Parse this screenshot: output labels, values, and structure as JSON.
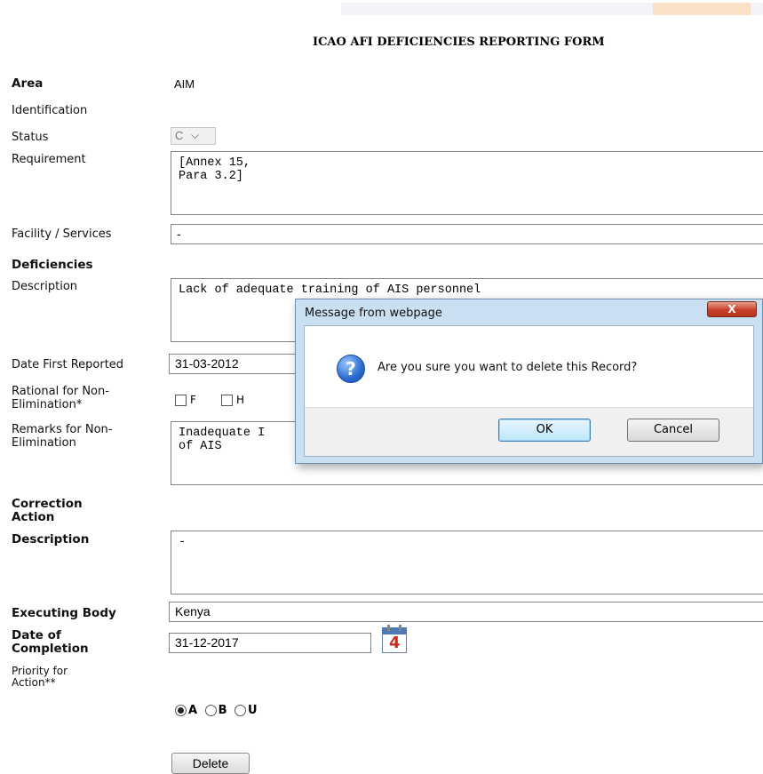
{
  "form": {
    "title": "ICAO AFI DEFICIENCIES REPORTING FORM",
    "area_label": "Area",
    "area_value": "AIM",
    "identification_label": "Identification",
    "status_label": "Status",
    "status_value": "C",
    "requirement_label": "Requirement",
    "requirement_value": "[Annex 15,\nPara 3.2]",
    "facility_label": "Facility / Services",
    "facility_value": "-",
    "deficiencies_heading": "Deficiencies",
    "description_label": "Description",
    "description_value": "Lack of adequate training of AIS personnel",
    "date_first_reported_label": "Date First Reported",
    "date_first_reported_value": "31-03-2012",
    "rational_label": "Rational for Non-Elimination*",
    "rational_options": [
      "F",
      "H"
    ],
    "remarks_label": "Remarks for Non-Elimination",
    "remarks_value_line1": "Inadequate I",
    "remarks_value_line2": "of AIS",
    "correction_heading": "Correction Action",
    "correction_description_label": "Description",
    "correction_description_value": "-",
    "executing_body_label": "Executing Body",
    "executing_body_value": "Kenya",
    "date_completion_label": "Date of Completion",
    "date_completion_value": "31-12-2017",
    "calendar_day": "4",
    "priority_label": "Priority for Action**",
    "priority_options": [
      "A",
      "B",
      "U"
    ],
    "priority_selected": "A",
    "delete_button": "Delete"
  },
  "dialog": {
    "title": "Message from webpage",
    "close_label": "X",
    "icon_glyph": "?",
    "message": "Are you sure you want to delete this Record?",
    "ok_label": "OK",
    "cancel_label": "Cancel"
  },
  "colors": {
    "dialog_frame": "#c9dff2",
    "close_button": "#c7412a"
  }
}
